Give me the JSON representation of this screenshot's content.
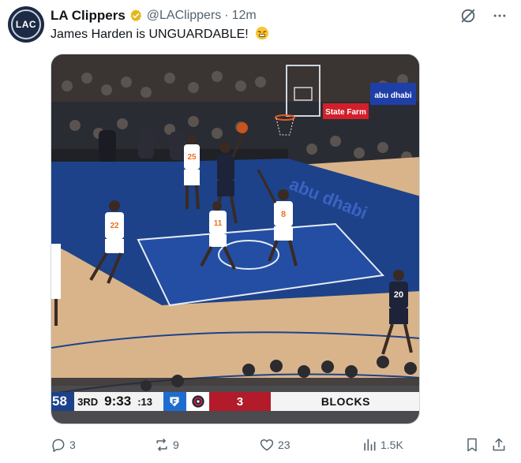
{
  "tweet": {
    "author_name": "LA Clippers",
    "avatar_text": "LAC",
    "handle": "@LAClippers",
    "separator": "·",
    "time": "12m",
    "text": "James Harden is UNGUARDABLE!",
    "emoji_icon": "frustrated-face-emoji",
    "verified_icon": "verified-gold-badge-icon"
  },
  "video": {
    "scoreboard": {
      "team_score": "58",
      "period": "3RD",
      "game_clock": "9:33",
      "shot_clock": ":13",
      "opponent_score": "3",
      "stat_label": "BLOCKS"
    },
    "arena_signs": {
      "sponsor_1": "abu dhabi",
      "sponsor_2": "State Farm"
    },
    "jerseys": {
      "left_player": "22",
      "defender_1": "25",
      "defender_2": "11",
      "defender_3": "8",
      "offense_right": "20"
    },
    "court_text": "abu dhabi"
  },
  "actions": {
    "replies": "3",
    "reposts": "9",
    "likes": "23",
    "views": "1.5K"
  },
  "colors": {
    "text_secondary": "#536471",
    "verified_gold": "#e2b719",
    "knicks_blue": "#1d428a",
    "court_wood": "#d9b48a"
  }
}
